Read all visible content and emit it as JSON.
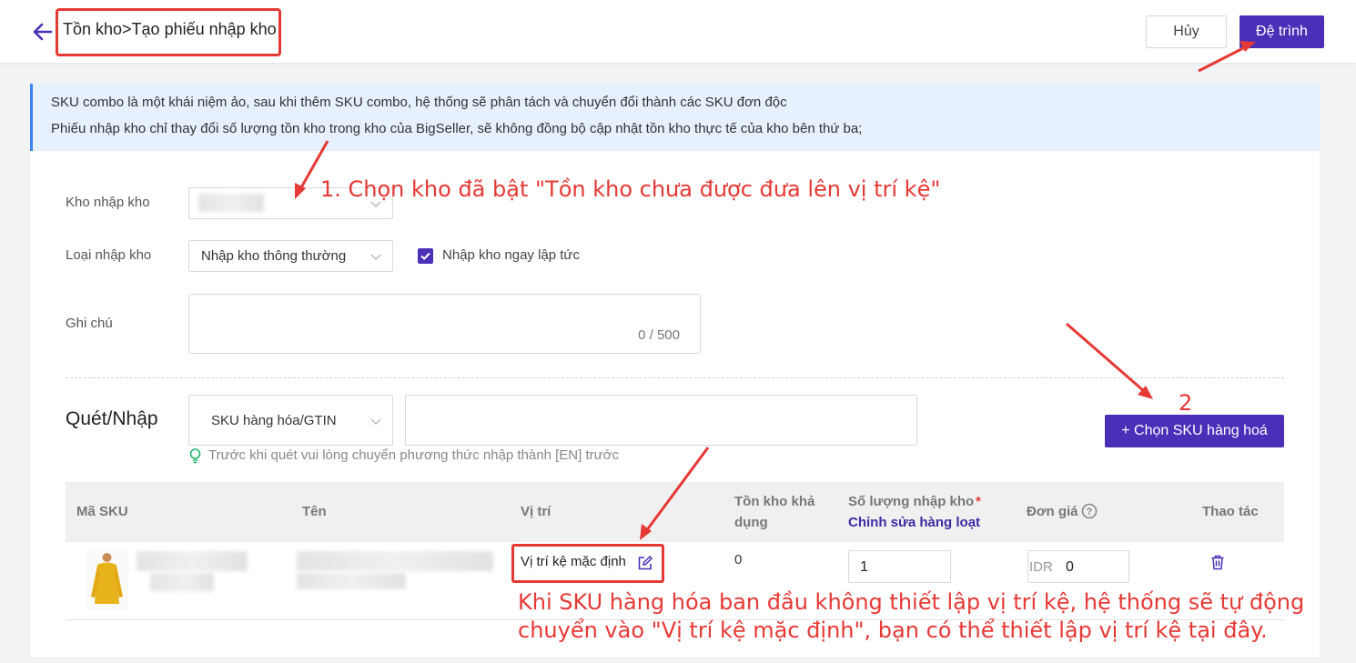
{
  "header": {
    "breadcrumb": "Tồn kho>Tạo phiếu nhập kho",
    "cancel_label": "Hủy",
    "submit_label": "Đệ trình"
  },
  "notice": {
    "line1": "SKU combo là một khái niệm ảo, sau khi thêm SKU combo, hệ thống sẽ phân tách và chuyển đổi thành các SKU đơn độc",
    "line2": "Phiếu nhập kho chỉ thay đổi số lượng tồn kho trong kho của BigSeller, sẽ không đồng bộ cập nhật tồn kho thực tế của kho bên thứ ba;"
  },
  "form": {
    "warehouse_label": "Kho nhập kho",
    "type_label": "Loại nhập kho",
    "type_value": "Nhập kho thông thường",
    "immediate_label": "Nhập kho ngay lập tức",
    "note_label": "Ghi chú",
    "note_counter": "0 / 500"
  },
  "scan": {
    "title": "Quét/Nhập",
    "mode_value": "SKU hàng hóa/GTIN",
    "hint": "Trước khi quét vui lòng chuyển phương thức nhập thành [EN] trước",
    "choose_button": "+ Chọn SKU hàng hoá"
  },
  "table": {
    "headers": {
      "sku": "Mã SKU",
      "name": "Tên",
      "location": "Vị trí",
      "available_1": "Tồn kho khả",
      "available_2": "dụng",
      "qty": "Số lượng nhập kho",
      "required": "*",
      "batch_edit": "Chỉnh sửa hàng loạt",
      "price": "Đơn giá",
      "action": "Thao tác"
    },
    "row": {
      "location": "Vị trí kệ mặc định",
      "available": "0",
      "qty": "1",
      "currency": "IDR",
      "price": "0"
    }
  },
  "annotations": {
    "step1": "1. Chọn kho đã bật \"Tồn kho chưa được đưa lên vị trí kệ\"",
    "step2": "2",
    "note_line1": "Khi SKU hàng hóa ban đầu không thiết lập vị trí kệ, hệ thống sẽ tự động",
    "note_line2": "chuyển vào \"Vị trí kệ mặc định\", bạn có thể thiết lập vị trí kệ tại đây."
  },
  "colors": {
    "primary": "#4b2fb8",
    "annotation": "#e53935",
    "notice_bg": "#e6f1fd",
    "hint_icon": "#22b36a"
  }
}
